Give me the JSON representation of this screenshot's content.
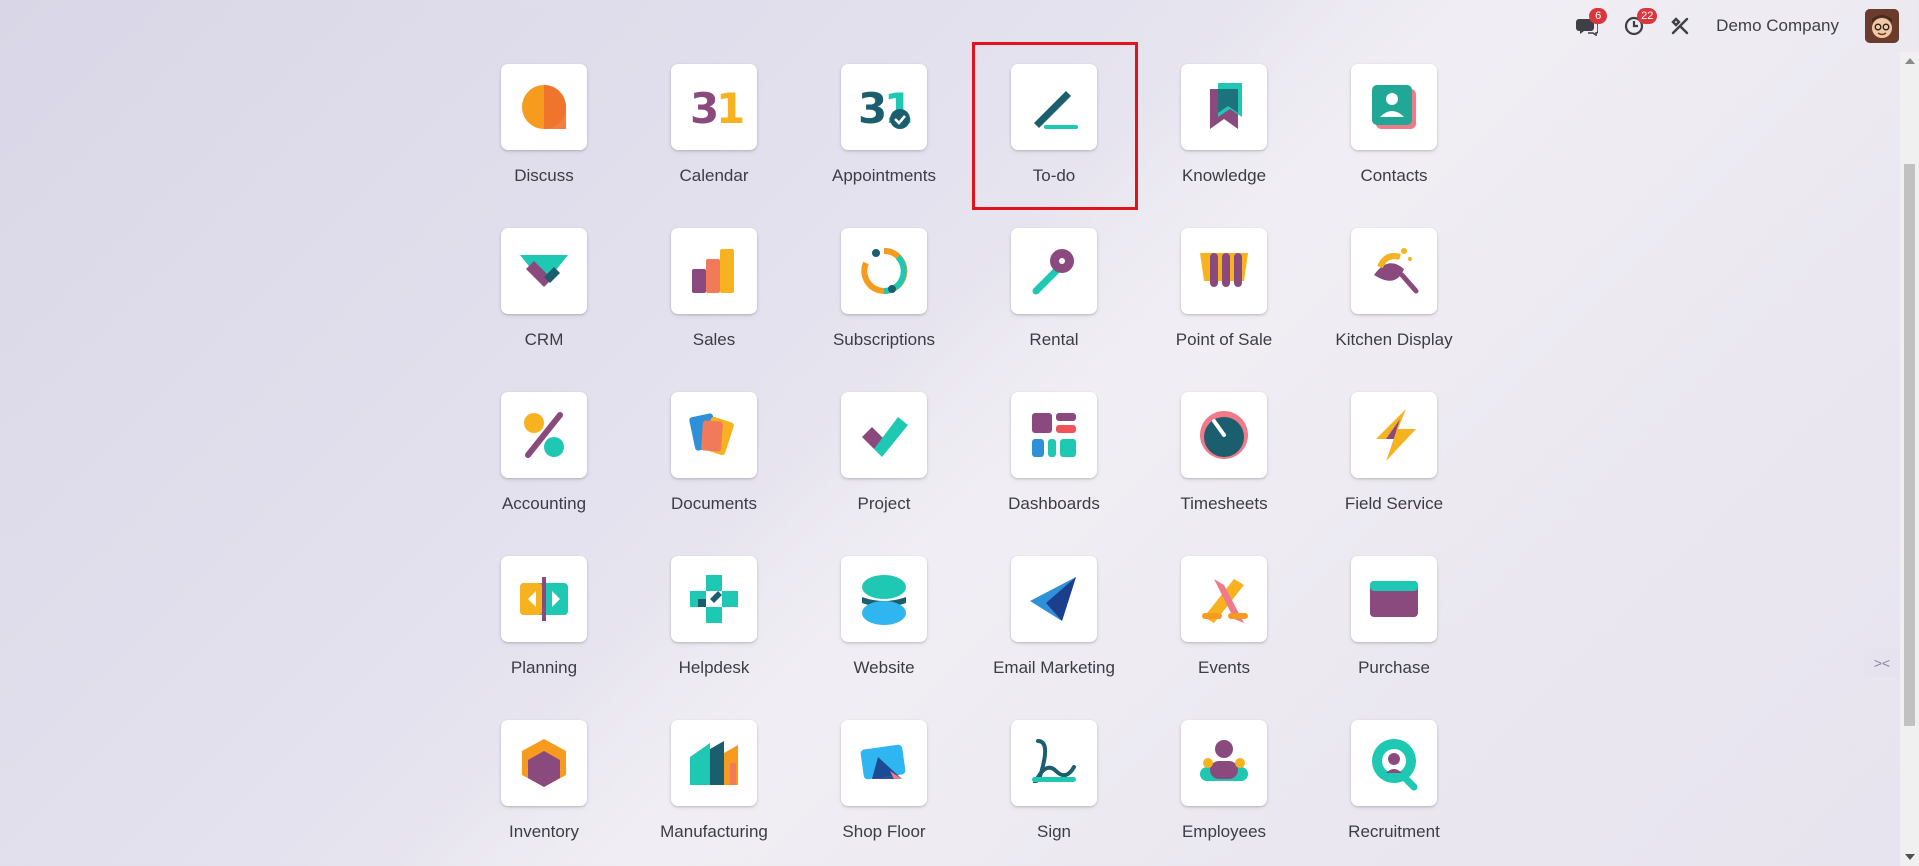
{
  "topbar": {
    "messages_badge": "6",
    "activity_badge": "22",
    "company_name": "Demo Company"
  },
  "highlighted_app": "To-do",
  "apps": [
    {
      "label": "Discuss",
      "icon": "discuss-icon"
    },
    {
      "label": "Calendar",
      "icon": "calendar-icon"
    },
    {
      "label": "Appointments",
      "icon": "appointments-icon"
    },
    {
      "label": "To-do",
      "icon": "todo-icon"
    },
    {
      "label": "Knowledge",
      "icon": "knowledge-icon"
    },
    {
      "label": "Contacts",
      "icon": "contacts-icon"
    },
    {
      "label": "CRM",
      "icon": "crm-icon"
    },
    {
      "label": "Sales",
      "icon": "sales-icon"
    },
    {
      "label": "Subscriptions",
      "icon": "subscriptions-icon"
    },
    {
      "label": "Rental",
      "icon": "rental-icon"
    },
    {
      "label": "Point of Sale",
      "icon": "point-of-sale-icon"
    },
    {
      "label": "Kitchen Display",
      "icon": "kitchen-display-icon"
    },
    {
      "label": "Accounting",
      "icon": "accounting-icon"
    },
    {
      "label": "Documents",
      "icon": "documents-icon"
    },
    {
      "label": "Project",
      "icon": "project-icon"
    },
    {
      "label": "Dashboards",
      "icon": "dashboards-icon"
    },
    {
      "label": "Timesheets",
      "icon": "timesheets-icon"
    },
    {
      "label": "Field Service",
      "icon": "field-service-icon"
    },
    {
      "label": "Planning",
      "icon": "planning-icon"
    },
    {
      "label": "Helpdesk",
      "icon": "helpdesk-icon"
    },
    {
      "label": "Website",
      "icon": "website-icon"
    },
    {
      "label": "Email Marketing",
      "icon": "email-marketing-icon"
    },
    {
      "label": "Events",
      "icon": "events-icon"
    },
    {
      "label": "Purchase",
      "icon": "purchase-icon"
    },
    {
      "label": "Inventory",
      "icon": "inventory-icon"
    },
    {
      "label": "Manufacturing",
      "icon": "manufacturing-icon"
    },
    {
      "label": "Shop Floor",
      "icon": "shop-floor-icon"
    },
    {
      "label": "Sign",
      "icon": "sign-icon"
    },
    {
      "label": "Employees",
      "icon": "employees-icon"
    },
    {
      "label": "Recruitment",
      "icon": "recruitment-icon"
    }
  ],
  "colors": {
    "highlight_border": "#e3131b",
    "badge": "#d9363e",
    "teal": "#1fc8b3",
    "purple": "#8b4a7e",
    "orange": "#f79b1f",
    "dark_teal": "#1b5e6d"
  }
}
